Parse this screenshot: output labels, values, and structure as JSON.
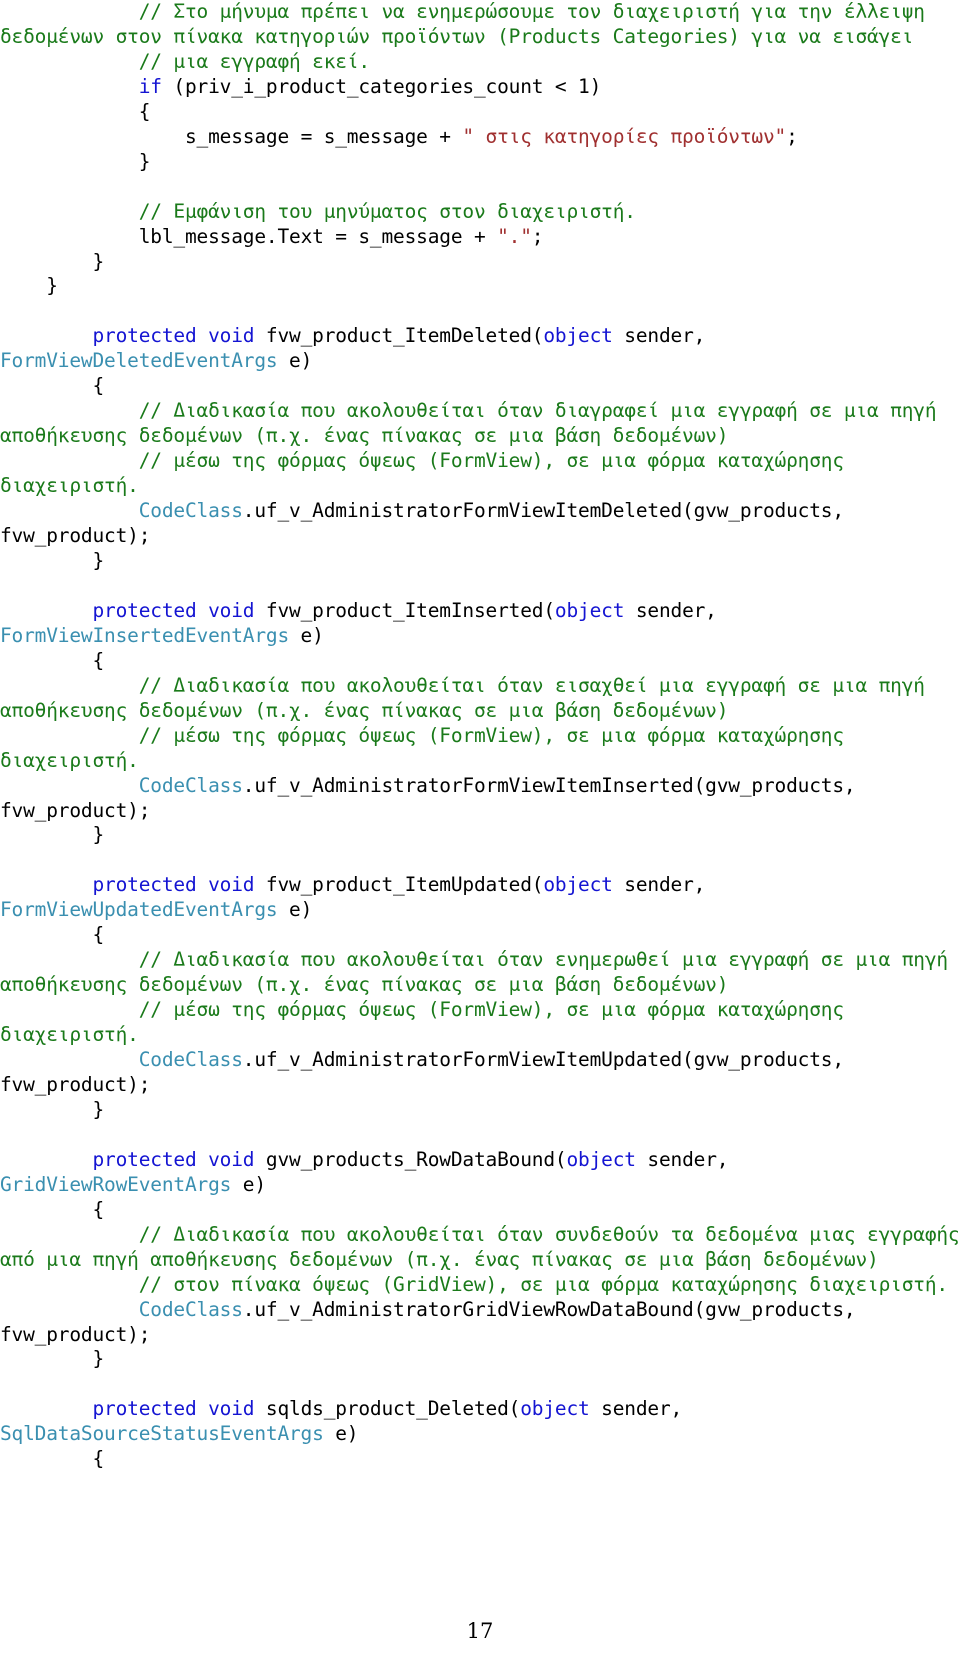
{
  "document": {
    "page_number": "17",
    "language": "C#",
    "colors": {
      "comment": "#1a7a1a",
      "keyword": "#1414d2",
      "type": "#3a8fb0",
      "string": "#a03030",
      "identifier": "#000000",
      "background": "#ffffff"
    }
  },
  "code_lines": [
    {
      "indent": "            ",
      "segments": [
        {
          "cls": "cmt",
          "text": "// Στο μήνυμα πρέπει να ενημερώσουμε τον διαχειριστή για την έλλειψη δεδομένων στον πίνακα κατηγοριών προϊόντων (Products Categories) για να εισάγει"
        }
      ]
    },
    {
      "indent": "            ",
      "segments": [
        {
          "cls": "cmt",
          "text": "// μια εγγραφή εκεί."
        }
      ]
    },
    {
      "indent": "            ",
      "segments": [
        {
          "cls": "kw",
          "text": "if"
        },
        {
          "cls": "id",
          "text": " (priv_i_product_categories_count < 1)"
        }
      ]
    },
    {
      "indent": "            ",
      "segments": [
        {
          "cls": "id",
          "text": "{"
        }
      ]
    },
    {
      "indent": "                ",
      "segments": [
        {
          "cls": "id",
          "text": "s_message = s_message + "
        },
        {
          "cls": "str",
          "text": "\" στις κατηγορίες προϊόντων\""
        },
        {
          "cls": "id",
          "text": ";"
        }
      ]
    },
    {
      "indent": "            ",
      "segments": [
        {
          "cls": "id",
          "text": "}"
        }
      ]
    },
    {
      "indent": "",
      "segments": [
        {
          "cls": "blank",
          "text": " "
        }
      ]
    },
    {
      "indent": "            ",
      "segments": [
        {
          "cls": "cmt",
          "text": "// Εμφάνιση του μηνύματος στον διαχειριστή."
        }
      ]
    },
    {
      "indent": "            ",
      "segments": [
        {
          "cls": "id",
          "text": "lbl_message.Text = s_message + "
        },
        {
          "cls": "str",
          "text": "\".\""
        },
        {
          "cls": "id",
          "text": ";"
        }
      ]
    },
    {
      "indent": "        ",
      "segments": [
        {
          "cls": "id",
          "text": "}"
        }
      ]
    },
    {
      "indent": "    ",
      "segments": [
        {
          "cls": "id",
          "text": "}"
        }
      ]
    },
    {
      "indent": "",
      "segments": [
        {
          "cls": "blank",
          "text": " "
        }
      ]
    },
    {
      "indent": "        ",
      "segments": [
        {
          "cls": "kw",
          "text": "protected void"
        },
        {
          "cls": "id",
          "text": " fvw_product_ItemDeleted("
        },
        {
          "cls": "kw",
          "text": "object"
        },
        {
          "cls": "id",
          "text": " sender, "
        },
        {
          "cls": "typ",
          "text": "FormViewDeletedEventArgs"
        },
        {
          "cls": "id",
          "text": " e)"
        }
      ]
    },
    {
      "indent": "        ",
      "segments": [
        {
          "cls": "id",
          "text": "{"
        }
      ]
    },
    {
      "indent": "            ",
      "segments": [
        {
          "cls": "cmt",
          "text": "// Διαδικασία που ακολουθείται όταν διαγραφεί μια εγγραφή σε μια πηγή αποθήκευσης δεδομένων (π.χ. ένας πίνακας σε μια βάση δεδομένων)"
        }
      ]
    },
    {
      "indent": "            ",
      "segments": [
        {
          "cls": "cmt",
          "text": "// μέσω της φόρμας όψεως (FormView), σε μια φόρμα καταχώρησης διαχειριστή."
        }
      ]
    },
    {
      "indent": "            ",
      "segments": [
        {
          "cls": "typ",
          "text": "CodeClass"
        },
        {
          "cls": "id",
          "text": ".uf_v_AdministratorFormViewItemDeleted(gvw_products, fvw_product);"
        }
      ]
    },
    {
      "indent": "        ",
      "segments": [
        {
          "cls": "id",
          "text": "}"
        }
      ]
    },
    {
      "indent": "",
      "segments": [
        {
          "cls": "blank",
          "text": " "
        }
      ]
    },
    {
      "indent": "        ",
      "segments": [
        {
          "cls": "kw",
          "text": "protected void"
        },
        {
          "cls": "id",
          "text": " fvw_product_ItemInserted("
        },
        {
          "cls": "kw",
          "text": "object"
        },
        {
          "cls": "id",
          "text": " sender, "
        },
        {
          "cls": "typ",
          "text": "FormViewInsertedEventArgs"
        },
        {
          "cls": "id",
          "text": " e)"
        }
      ]
    },
    {
      "indent": "        ",
      "segments": [
        {
          "cls": "id",
          "text": "{"
        }
      ]
    },
    {
      "indent": "            ",
      "segments": [
        {
          "cls": "cmt",
          "text": "// Διαδικασία που ακολουθείται όταν εισαχθεί μια εγγραφή σε μια πηγή αποθήκευσης δεδομένων (π.χ. ένας πίνακας σε μια βάση δεδομένων)"
        }
      ]
    },
    {
      "indent": "            ",
      "segments": [
        {
          "cls": "cmt",
          "text": "// μέσω της φόρμας όψεως (FormView), σε μια φόρμα καταχώρησης διαχειριστή."
        }
      ]
    },
    {
      "indent": "            ",
      "segments": [
        {
          "cls": "typ",
          "text": "CodeClass"
        },
        {
          "cls": "id",
          "text": ".uf_v_AdministratorFormViewItemInserted(gvw_products, fvw_product);"
        }
      ]
    },
    {
      "indent": "        ",
      "segments": [
        {
          "cls": "id",
          "text": "}"
        }
      ]
    },
    {
      "indent": "",
      "segments": [
        {
          "cls": "blank",
          "text": " "
        }
      ]
    },
    {
      "indent": "        ",
      "segments": [
        {
          "cls": "kw",
          "text": "protected void"
        },
        {
          "cls": "id",
          "text": " fvw_product_ItemUpdated("
        },
        {
          "cls": "kw",
          "text": "object"
        },
        {
          "cls": "id",
          "text": " sender, "
        },
        {
          "cls": "typ",
          "text": "FormViewUpdatedEventArgs"
        },
        {
          "cls": "id",
          "text": " e)"
        }
      ]
    },
    {
      "indent": "        ",
      "segments": [
        {
          "cls": "id",
          "text": "{"
        }
      ]
    },
    {
      "indent": "            ",
      "segments": [
        {
          "cls": "cmt",
          "text": "// Διαδικασία που ακολουθείται όταν ενημερωθεί μια εγγραφή σε μια πηγή αποθήκευσης δεδομένων (π.χ. ένας πίνακας σε μια βάση δεδομένων)"
        }
      ]
    },
    {
      "indent": "            ",
      "segments": [
        {
          "cls": "cmt",
          "text": "// μέσω της φόρμας όψεως (FormView), σε μια φόρμα καταχώρησης διαχειριστή."
        }
      ]
    },
    {
      "indent": "            ",
      "segments": [
        {
          "cls": "typ",
          "text": "CodeClass"
        },
        {
          "cls": "id",
          "text": ".uf_v_AdministratorFormViewItemUpdated(gvw_products, fvw_product);"
        }
      ]
    },
    {
      "indent": "        ",
      "segments": [
        {
          "cls": "id",
          "text": "}"
        }
      ]
    },
    {
      "indent": "",
      "segments": [
        {
          "cls": "blank",
          "text": " "
        }
      ]
    },
    {
      "indent": "        ",
      "segments": [
        {
          "cls": "kw",
          "text": "protected void"
        },
        {
          "cls": "id",
          "text": " gvw_products_RowDataBound("
        },
        {
          "cls": "kw",
          "text": "object"
        },
        {
          "cls": "id",
          "text": " sender, "
        },
        {
          "cls": "typ",
          "text": "GridViewRowEventArgs"
        },
        {
          "cls": "id",
          "text": " e)"
        }
      ]
    },
    {
      "indent": "        ",
      "segments": [
        {
          "cls": "id",
          "text": "{"
        }
      ]
    },
    {
      "indent": "            ",
      "segments": [
        {
          "cls": "cmt",
          "text": "// Διαδικασία που ακολουθείται όταν συνδεθούν τα δεδομένα μιας εγγραφής από μια πηγή αποθήκευσης δεδομένων (π.χ. ένας πίνακας σε μια βάση δεδομένων)"
        }
      ]
    },
    {
      "indent": "            ",
      "segments": [
        {
          "cls": "cmt",
          "text": "// στον πίνακα όψεως (GridView), σε μια φόρμα καταχώρησης διαχειριστή."
        }
      ]
    },
    {
      "indent": "            ",
      "segments": [
        {
          "cls": "typ",
          "text": "CodeClass"
        },
        {
          "cls": "id",
          "text": ".uf_v_AdministratorGridViewRowDataBound(gvw_products, fvw_product);"
        }
      ]
    },
    {
      "indent": "        ",
      "segments": [
        {
          "cls": "id",
          "text": "}"
        }
      ]
    },
    {
      "indent": "",
      "segments": [
        {
          "cls": "blank",
          "text": " "
        }
      ]
    },
    {
      "indent": "        ",
      "segments": [
        {
          "cls": "kw",
          "text": "protected void"
        },
        {
          "cls": "id",
          "text": " sqlds_product_Deleted("
        },
        {
          "cls": "kw",
          "text": "object"
        },
        {
          "cls": "id",
          "text": " sender, "
        },
        {
          "cls": "typ",
          "text": "SqlDataSourceStatusEventArgs"
        },
        {
          "cls": "id",
          "text": " e)"
        }
      ]
    },
    {
      "indent": "        ",
      "segments": [
        {
          "cls": "id",
          "text": "{"
        }
      ]
    }
  ]
}
